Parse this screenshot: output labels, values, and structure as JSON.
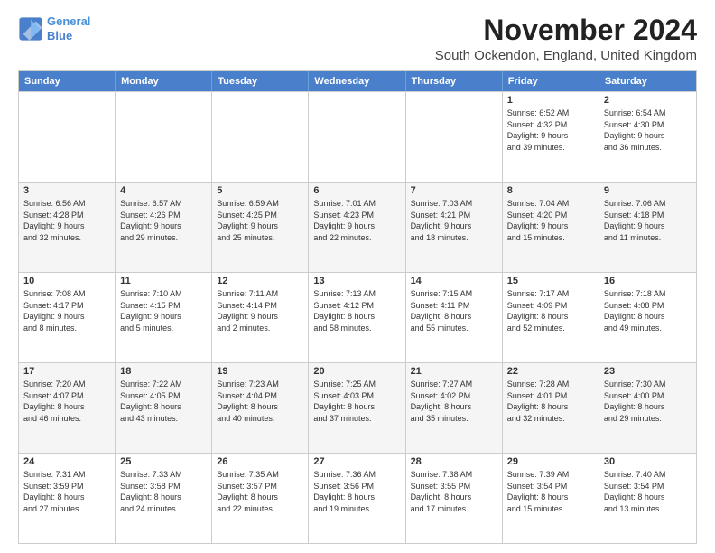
{
  "logo": {
    "line1": "General",
    "line2": "Blue"
  },
  "title": "November 2024",
  "location": "South Ockendon, England, United Kingdom",
  "header_days": [
    "Sunday",
    "Monday",
    "Tuesday",
    "Wednesday",
    "Thursday",
    "Friday",
    "Saturday"
  ],
  "rows": [
    [
      {
        "day": "",
        "text": ""
      },
      {
        "day": "",
        "text": ""
      },
      {
        "day": "",
        "text": ""
      },
      {
        "day": "",
        "text": ""
      },
      {
        "day": "",
        "text": ""
      },
      {
        "day": "1",
        "text": "Sunrise: 6:52 AM\nSunset: 4:32 PM\nDaylight: 9 hours\nand 39 minutes."
      },
      {
        "day": "2",
        "text": "Sunrise: 6:54 AM\nSunset: 4:30 PM\nDaylight: 9 hours\nand 36 minutes."
      }
    ],
    [
      {
        "day": "3",
        "text": "Sunrise: 6:56 AM\nSunset: 4:28 PM\nDaylight: 9 hours\nand 32 minutes."
      },
      {
        "day": "4",
        "text": "Sunrise: 6:57 AM\nSunset: 4:26 PM\nDaylight: 9 hours\nand 29 minutes."
      },
      {
        "day": "5",
        "text": "Sunrise: 6:59 AM\nSunset: 4:25 PM\nDaylight: 9 hours\nand 25 minutes."
      },
      {
        "day": "6",
        "text": "Sunrise: 7:01 AM\nSunset: 4:23 PM\nDaylight: 9 hours\nand 22 minutes."
      },
      {
        "day": "7",
        "text": "Sunrise: 7:03 AM\nSunset: 4:21 PM\nDaylight: 9 hours\nand 18 minutes."
      },
      {
        "day": "8",
        "text": "Sunrise: 7:04 AM\nSunset: 4:20 PM\nDaylight: 9 hours\nand 15 minutes."
      },
      {
        "day": "9",
        "text": "Sunrise: 7:06 AM\nSunset: 4:18 PM\nDaylight: 9 hours\nand 11 minutes."
      }
    ],
    [
      {
        "day": "10",
        "text": "Sunrise: 7:08 AM\nSunset: 4:17 PM\nDaylight: 9 hours\nand 8 minutes."
      },
      {
        "day": "11",
        "text": "Sunrise: 7:10 AM\nSunset: 4:15 PM\nDaylight: 9 hours\nand 5 minutes."
      },
      {
        "day": "12",
        "text": "Sunrise: 7:11 AM\nSunset: 4:14 PM\nDaylight: 9 hours\nand 2 minutes."
      },
      {
        "day": "13",
        "text": "Sunrise: 7:13 AM\nSunset: 4:12 PM\nDaylight: 8 hours\nand 58 minutes."
      },
      {
        "day": "14",
        "text": "Sunrise: 7:15 AM\nSunset: 4:11 PM\nDaylight: 8 hours\nand 55 minutes."
      },
      {
        "day": "15",
        "text": "Sunrise: 7:17 AM\nSunset: 4:09 PM\nDaylight: 8 hours\nand 52 minutes."
      },
      {
        "day": "16",
        "text": "Sunrise: 7:18 AM\nSunset: 4:08 PM\nDaylight: 8 hours\nand 49 minutes."
      }
    ],
    [
      {
        "day": "17",
        "text": "Sunrise: 7:20 AM\nSunset: 4:07 PM\nDaylight: 8 hours\nand 46 minutes."
      },
      {
        "day": "18",
        "text": "Sunrise: 7:22 AM\nSunset: 4:05 PM\nDaylight: 8 hours\nand 43 minutes."
      },
      {
        "day": "19",
        "text": "Sunrise: 7:23 AM\nSunset: 4:04 PM\nDaylight: 8 hours\nand 40 minutes."
      },
      {
        "day": "20",
        "text": "Sunrise: 7:25 AM\nSunset: 4:03 PM\nDaylight: 8 hours\nand 37 minutes."
      },
      {
        "day": "21",
        "text": "Sunrise: 7:27 AM\nSunset: 4:02 PM\nDaylight: 8 hours\nand 35 minutes."
      },
      {
        "day": "22",
        "text": "Sunrise: 7:28 AM\nSunset: 4:01 PM\nDaylight: 8 hours\nand 32 minutes."
      },
      {
        "day": "23",
        "text": "Sunrise: 7:30 AM\nSunset: 4:00 PM\nDaylight: 8 hours\nand 29 minutes."
      }
    ],
    [
      {
        "day": "24",
        "text": "Sunrise: 7:31 AM\nSunset: 3:59 PM\nDaylight: 8 hours\nand 27 minutes."
      },
      {
        "day": "25",
        "text": "Sunrise: 7:33 AM\nSunset: 3:58 PM\nDaylight: 8 hours\nand 24 minutes."
      },
      {
        "day": "26",
        "text": "Sunrise: 7:35 AM\nSunset: 3:57 PM\nDaylight: 8 hours\nand 22 minutes."
      },
      {
        "day": "27",
        "text": "Sunrise: 7:36 AM\nSunset: 3:56 PM\nDaylight: 8 hours\nand 19 minutes."
      },
      {
        "day": "28",
        "text": "Sunrise: 7:38 AM\nSunset: 3:55 PM\nDaylight: 8 hours\nand 17 minutes."
      },
      {
        "day": "29",
        "text": "Sunrise: 7:39 AM\nSunset: 3:54 PM\nDaylight: 8 hours\nand 15 minutes."
      },
      {
        "day": "30",
        "text": "Sunrise: 7:40 AM\nSunset: 3:54 PM\nDaylight: 8 hours\nand 13 minutes."
      }
    ]
  ],
  "colors": {
    "header_bg": "#4a7fcb",
    "alt_row": "#f5f5f5"
  }
}
